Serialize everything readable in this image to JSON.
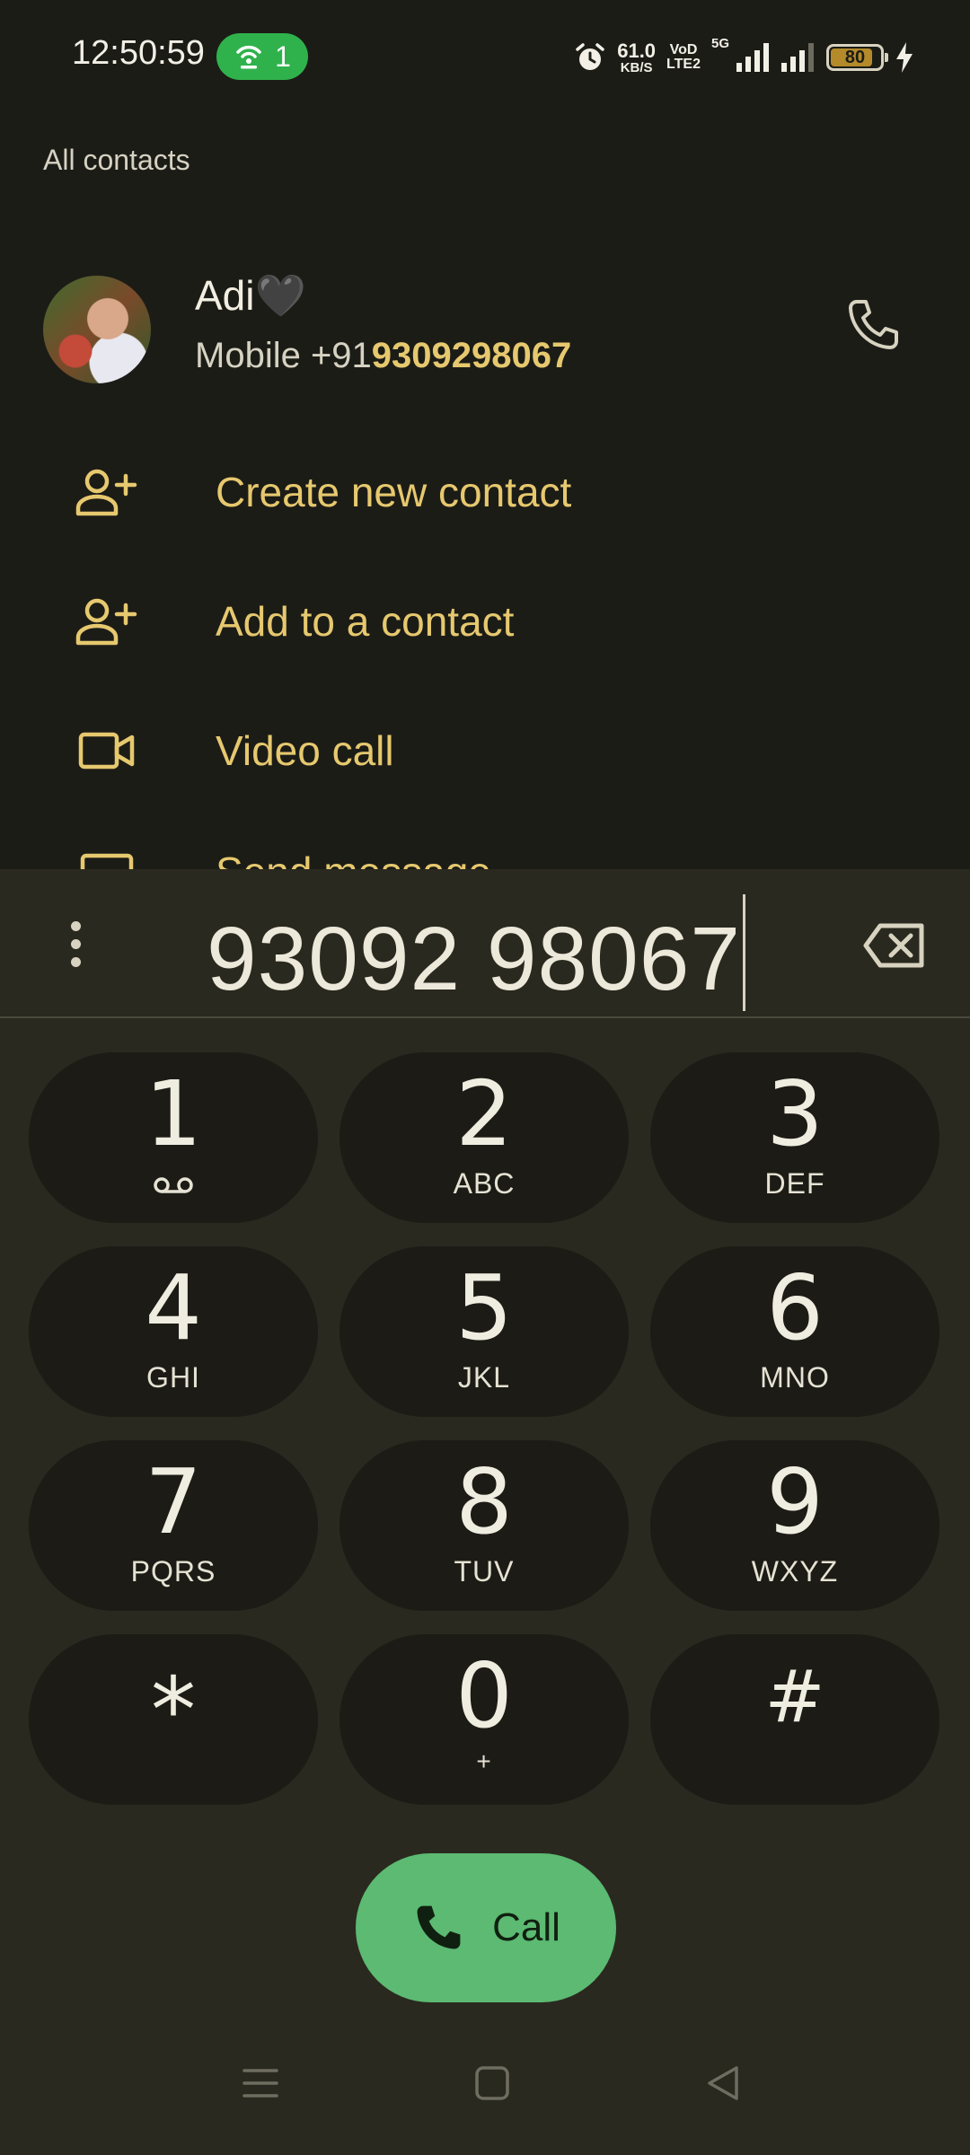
{
  "status_bar": {
    "time": "12:50:59",
    "hotspot_count": "1",
    "speed_value": "61.0",
    "speed_unit": "KB/S",
    "volte_top": "VoD",
    "volte_bottom": "LTE2",
    "network": "5G",
    "battery": "80"
  },
  "header": {
    "all_contacts": "All contacts"
  },
  "contact": {
    "name": "Adi🖤",
    "sub_prefix": "Mobile +91",
    "sub_number": "9309298067"
  },
  "actions": [
    {
      "label": "Create new contact",
      "icon": "add-person-icon"
    },
    {
      "label": "Add to a contact",
      "icon": "add-person-icon"
    },
    {
      "label": "Video call",
      "icon": "video-camera-icon"
    },
    {
      "label": "Send message",
      "icon": "message-icon"
    }
  ],
  "dialer": {
    "number": "93092 98067",
    "keys": [
      {
        "digit": "1",
        "sub": ""
      },
      {
        "digit": "2",
        "sub": "ABC"
      },
      {
        "digit": "3",
        "sub": "DEF"
      },
      {
        "digit": "4",
        "sub": "GHI"
      },
      {
        "digit": "5",
        "sub": "JKL"
      },
      {
        "digit": "6",
        "sub": "MNO"
      },
      {
        "digit": "7",
        "sub": "PQRS"
      },
      {
        "digit": "8",
        "sub": "TUV"
      },
      {
        "digit": "9",
        "sub": "WXYZ"
      },
      {
        "digit": "*",
        "sub": ""
      },
      {
        "digit": "0",
        "sub": "+"
      },
      {
        "digit": "#",
        "sub": ""
      }
    ],
    "call_label": "Call"
  },
  "colors": {
    "accent": "#e6c86e",
    "call_green": "#5cba72",
    "hotspot_green": "#2fb24c",
    "background": "#1c1c17",
    "dialer_bg": "#2a291f"
  }
}
